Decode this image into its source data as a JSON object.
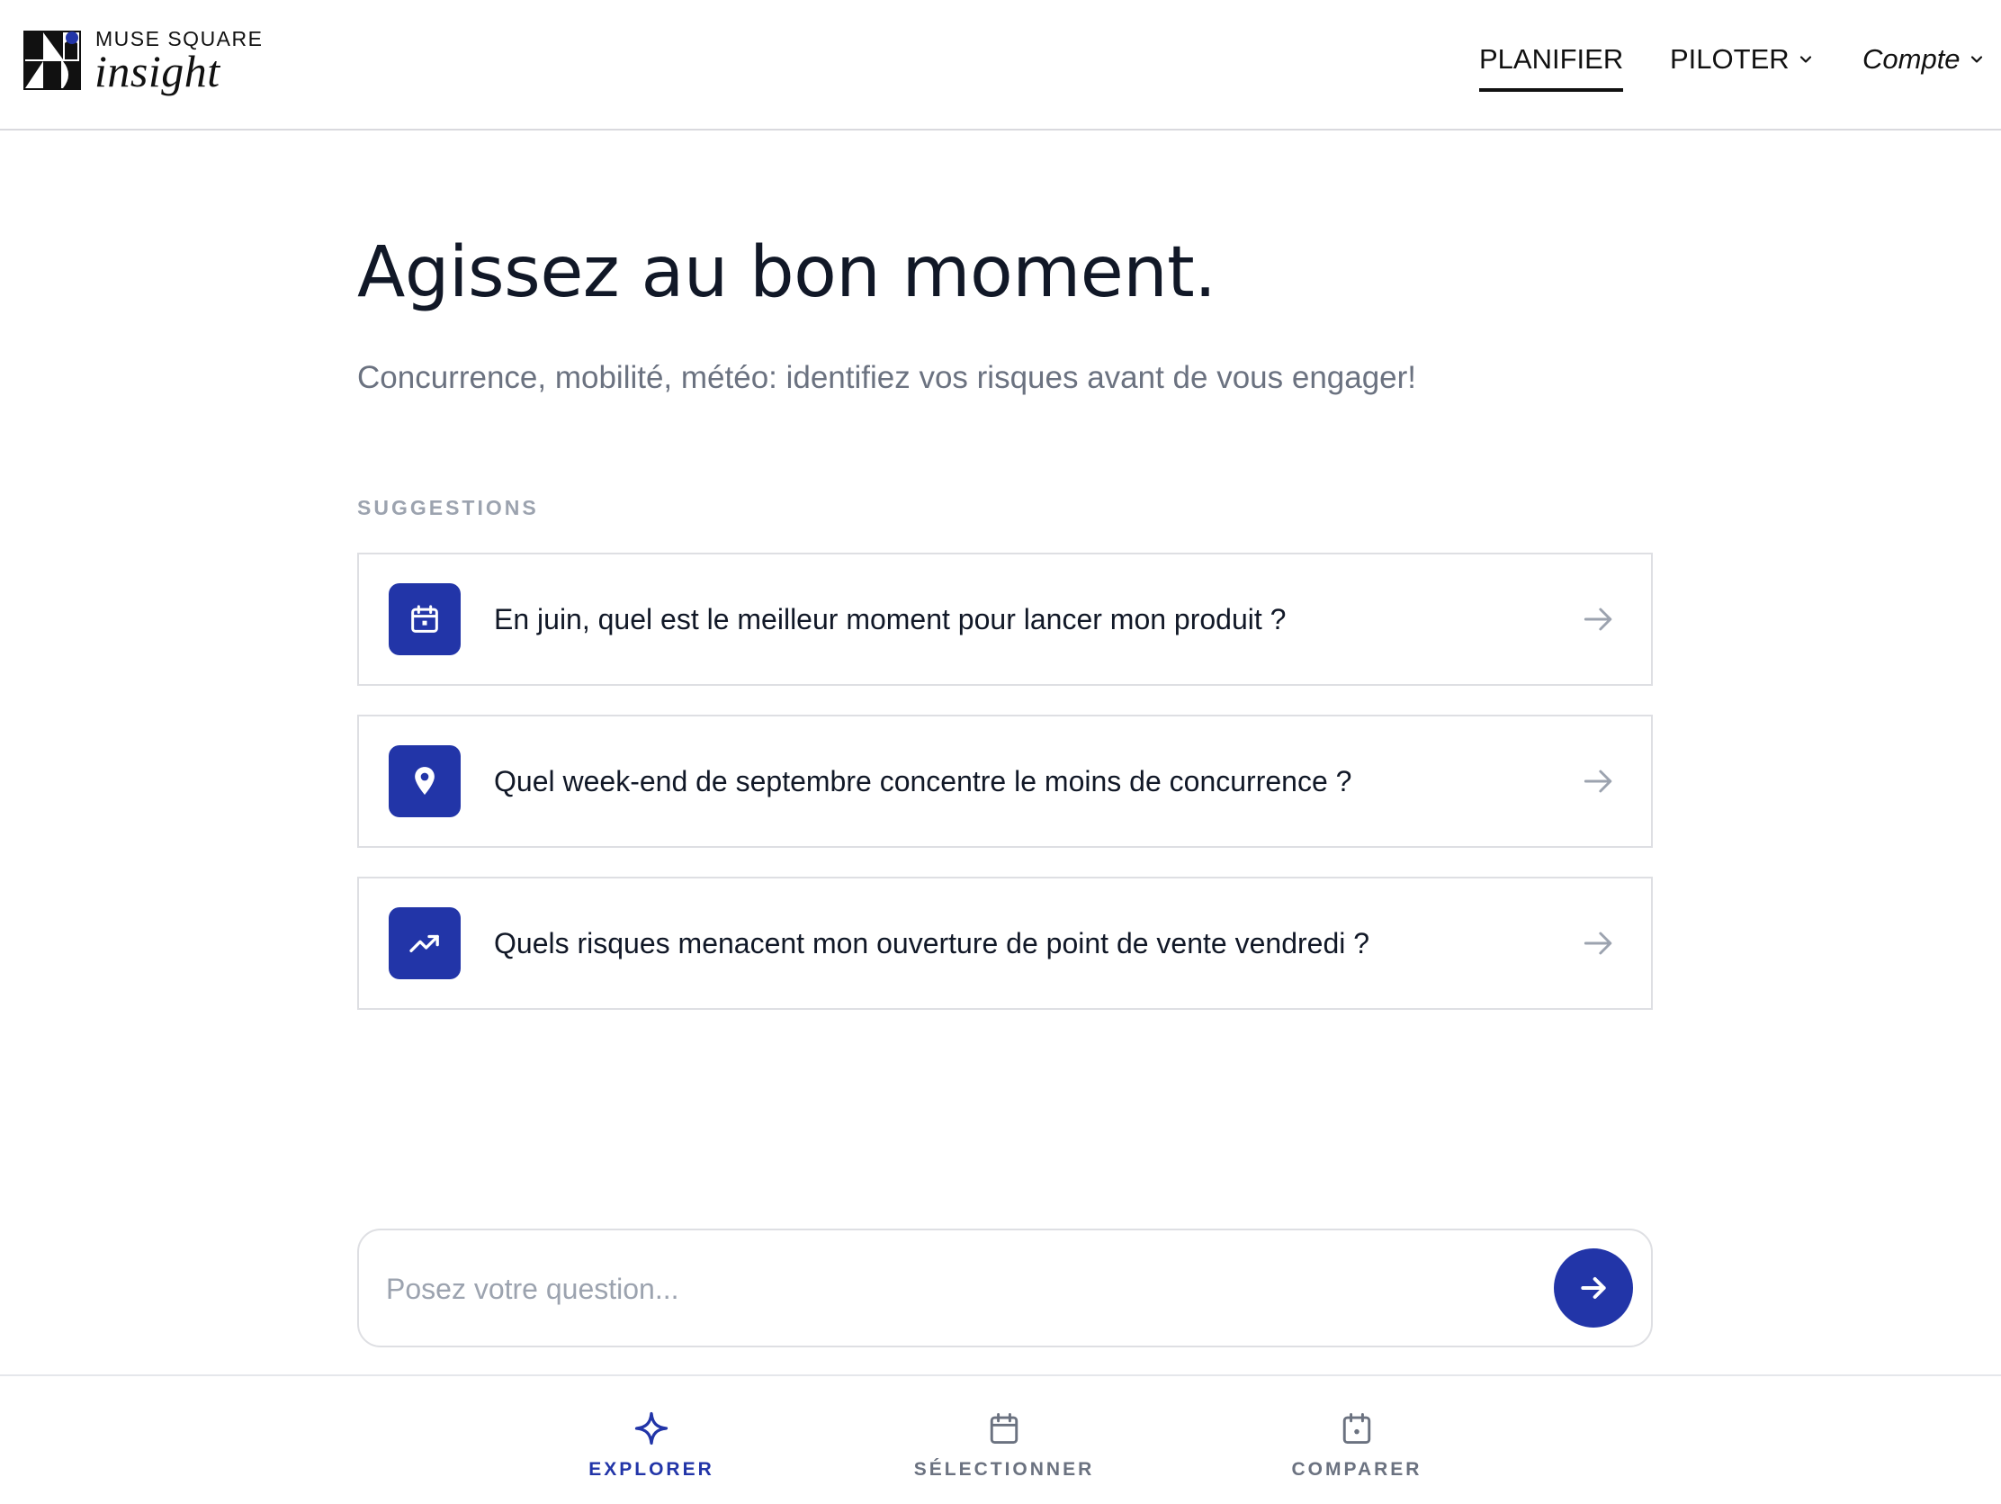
{
  "brand": {
    "company": "MUSE SQUARE",
    "product": "insight",
    "accent_color": "#2235a8"
  },
  "nav": {
    "planifier": "PLANIFIER",
    "piloter": "PILOTER",
    "compte": "Compte",
    "active": "planifier"
  },
  "hero": {
    "title": "Agissez au bon moment.",
    "subtitle": "Concurrence, mobilité, météo: identifiez vos risques avant de vous engager!"
  },
  "suggestions": {
    "label": "SUGGESTIONS",
    "items": [
      {
        "icon": "calendar-icon",
        "text": "En juin, quel est le meilleur moment pour lancer mon produit ?"
      },
      {
        "icon": "map-pin-icon",
        "text": "Quel week-end de septembre concentre le moins de concurrence ?"
      },
      {
        "icon": "trending-up-icon",
        "text": "Quels risques menacent mon ouverture de point de vente vendredi ?"
      }
    ]
  },
  "ask": {
    "placeholder": "Posez votre question...",
    "value": ""
  },
  "tabs": [
    {
      "label": "EXPLORER",
      "icon": "sparkle-icon",
      "active": true
    },
    {
      "label": "SÉLECTIONNER",
      "icon": "calendar-icon",
      "active": false
    },
    {
      "label": "COMPARER",
      "icon": "calendar-dot-icon",
      "active": false
    }
  ]
}
